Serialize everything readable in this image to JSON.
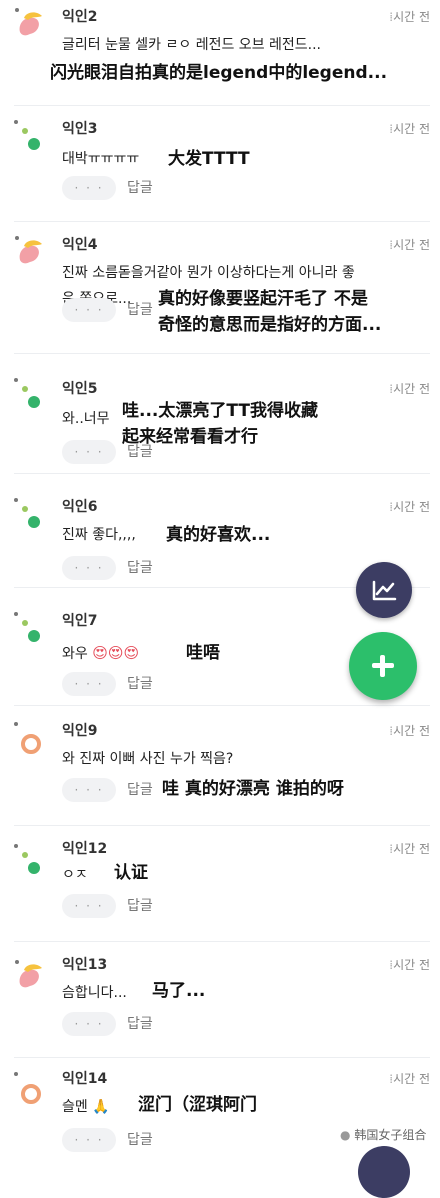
{
  "comments": [
    {
      "author": "익인2",
      "time": "시간 전",
      "text": "글리터 눈물 셀카 ㄹㅇ 레전드 오브 레전드...",
      "translation": "闪光眼泪自拍真的是legend中的legend..."
    },
    {
      "author": "익인3",
      "time": "시간 전",
      "text": "대박ㅠㅠㅠㅠ",
      "translation": "大发TTTT",
      "more": "· · ·",
      "reply": "답글"
    },
    {
      "author": "익인4",
      "time": "시간 전",
      "text_lines": [
        "진짜 소름돋을거같아 뭔가 이상하다는게 아니라 좋",
        "은 쪽으로..."
      ],
      "translation_lines": [
        "真的好像要竖起汗毛了 不是",
        "奇怪的意思而是指好的方面..."
      ],
      "more": "· · ·",
      "reply": "답글"
    },
    {
      "author": "익인5",
      "time": "시간 전",
      "text": "와..너무",
      "translation_lines": [
        "哇...太漂亮了TT我得收藏",
        "起来经常看看才行"
      ],
      "more": "· · ·",
      "reply": "답글"
    },
    {
      "author": "익인6",
      "time": "시간 전",
      "text": "진짜 좋다,,,,",
      "translation": "真的好喜欢...",
      "more": "· · ·",
      "reply": "답글"
    },
    {
      "author": "익인7",
      "text": "와우",
      "emoji": "😍😍😍",
      "translation": "哇唔",
      "more": "· · ·",
      "reply": "답글"
    },
    {
      "author": "익인9",
      "time": "시간 전",
      "text": "와 진짜 이뻐 사진 누가 찍음?",
      "translation": "哇 真的好漂亮 谁拍的呀",
      "more": "· · ·",
      "reply": "답글"
    },
    {
      "author": "익인12",
      "time": "시간 전",
      "text": "ㅇㅈ",
      "translation": "认证",
      "more": "· · ·",
      "reply": "답글"
    },
    {
      "author": "익인13",
      "time": "시간 전",
      "text": "슴합니다...",
      "translation": "马了...",
      "more": "· · ·",
      "reply": "답글"
    },
    {
      "author": "익인14",
      "time": "시간 전",
      "text": "슬멘",
      "emoji": "🙏",
      "translation": "涩门（涩琪阿门",
      "more": "· · ·",
      "reply": "답글"
    }
  ],
  "watermark": "韩国女子组合",
  "icons": {
    "avatar_a": "pink-yellow-avatar-icon",
    "avatar_b": "green-dots-avatar-icon",
    "avatar_c": "orange-ring-avatar-icon",
    "time_icon": "clock-icon",
    "fab_chart": "chart-icon",
    "fab_add": "plus-icon"
  },
  "colors": {
    "fab_chart": "#3c3d63",
    "fab_add": "#2cbf6b",
    "avatar_green": "#34b36b",
    "avatar_orange": "#f0a074"
  }
}
